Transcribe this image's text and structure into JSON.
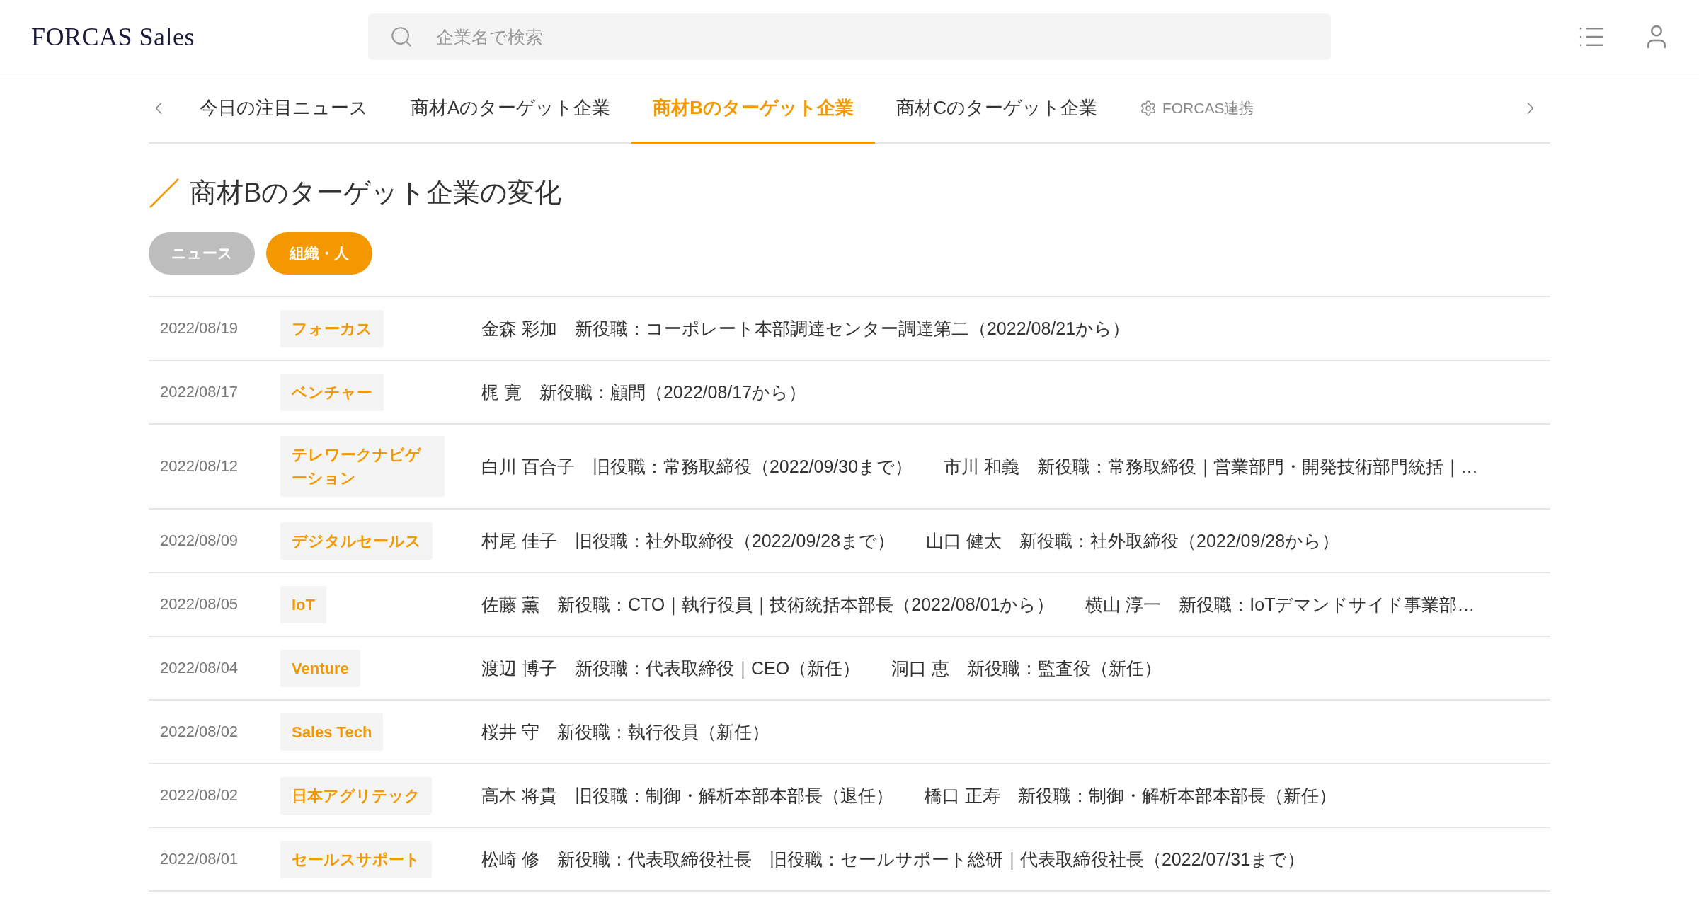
{
  "header": {
    "logo": "FORCAS Sales",
    "search": {
      "placeholder": "企業名で検索"
    }
  },
  "tabs": [
    {
      "label": "今日の注目ニュース",
      "kind": "text",
      "selected": false
    },
    {
      "label": "商材Aのターゲット企業",
      "kind": "text",
      "selected": false
    },
    {
      "label": "商材Bのターゲット企業",
      "kind": "text",
      "selected": true
    },
    {
      "label": "商材Cのターゲット企業",
      "kind": "text",
      "selected": false
    },
    {
      "label": "FORCAS連携",
      "kind": "settings",
      "selected": false
    }
  ],
  "section_title": "商材Bのターゲット企業の変化",
  "filters": [
    {
      "label": "ニュース",
      "selected": false
    },
    {
      "label": "組織・人",
      "selected": true
    }
  ],
  "rows": [
    {
      "date": "2022/08/19",
      "company": "フォーカス",
      "people": [
        "金森 彩加　新役職：コーポレート本部調達センター調達第二（2022/08/21から）"
      ]
    },
    {
      "date": "2022/08/17",
      "company": "ベンチャー",
      "people": [
        "梶 寛　新役職：顧問（2022/08/17から）"
      ]
    },
    {
      "date": "2022/08/12",
      "company": "テレワークナビゲーション",
      "people": [
        "白川 百合子　旧役職：常務取締役（2022/09/30まで）",
        "市川 和義　新役職：常務取締役｜営業部門・開発技術部門統括｜…"
      ]
    },
    {
      "date": "2022/08/09",
      "company": "デジタルセールス",
      "people": [
        "村尾 佳子　旧役職：社外取締役（2022/09/28まで）",
        "山口 健太　新役職：社外取締役（2022/09/28から）"
      ]
    },
    {
      "date": "2022/08/05",
      "company": "IoT",
      "people": [
        "佐藤 薫　新役職：CTO｜執行役員｜技術統括本部長（2022/08/01から）",
        "横山 淳一　新役職：IoTデマンドサイド事業部…"
      ]
    },
    {
      "date": "2022/08/04",
      "company": "Venture",
      "people": [
        "渡辺 博子　新役職：代表取締役｜CEO（新任）",
        "洞口 恵　新役職：監査役（新任）"
      ]
    },
    {
      "date": "2022/08/02",
      "company": "Sales Tech",
      "people": [
        "桜井 守　新役職：執行役員（新任）"
      ]
    },
    {
      "date": "2022/08/02",
      "company": "日本アグリテック",
      "people": [
        "高木 将貴　旧役職：制御・解析本部本部長（退任）",
        "橋口 正寿　新役職：制御・解析本部本部長（新任）"
      ]
    },
    {
      "date": "2022/08/01",
      "company": "セールスサポート",
      "people": [
        "松崎 修　新役職：代表取締役社長　旧役職：セールサポート総研｜代表取締役社長（2022/07/31まで）"
      ]
    }
  ]
}
